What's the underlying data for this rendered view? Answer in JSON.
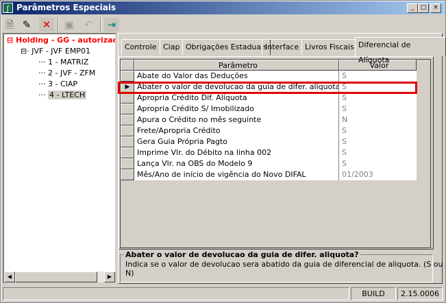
{
  "window": {
    "title": "Parâmetros Especiais",
    "controls": [
      "_",
      "□",
      "×"
    ]
  },
  "toolbar": {
    "icons": [
      "new-icon",
      "edit-icon",
      "delete-icon",
      "save-icon",
      "undo-icon",
      "exit-icon"
    ]
  },
  "tree": {
    "root": "Holding -  GG -  autorizada",
    "company": "JVF - JVF  EMP01",
    "branches": [
      "1 - MATRIZ",
      "2 - JVF - ZFM",
      "3 - CIAP",
      "4 - LTECH"
    ]
  },
  "tabs": [
    "Controle",
    "Ciap",
    "Obrigações Estaduais",
    "Interface",
    "Livros Fiscais",
    "Diferencial de Alíquota"
  ],
  "grid": {
    "headers": [
      "Parâmetro",
      "Valor"
    ],
    "rows": [
      {
        "param": "Abate do Valor das Deduções",
        "value": "S"
      },
      {
        "param": "Abater o valor de devolucao da guia de difer. aliquota?",
        "value": "S"
      },
      {
        "param": "Apropria Crédito Dif. Alíquota",
        "value": "S"
      },
      {
        "param": "Apropria Crédito S/ Imobilizado",
        "value": "S"
      },
      {
        "param": "Apura o Crédito no mês seguinte",
        "value": "N"
      },
      {
        "param": "Frete/Apropria Crédito",
        "value": "S"
      },
      {
        "param": "Gera Guia Própria Pagto",
        "value": "S"
      },
      {
        "param": "Imprime Vlr. do Débito na linha 002",
        "value": "S"
      },
      {
        "param": "Lança Vlr. na OBS do Modelo 9",
        "value": "S"
      },
      {
        "param": "Mês/Ano de início de vigência do Novo DIFAL",
        "value": "01/2003"
      }
    ]
  },
  "description": {
    "title": "Abater o valor de devolucao da guia de difer. aliquota?",
    "text": "Indica se o valor de devolucao sera abatido da guia de diferencial de aliquota. (S ou N)"
  },
  "status": {
    "build_label": "BUILD",
    "version": "2.15.0006"
  }
}
